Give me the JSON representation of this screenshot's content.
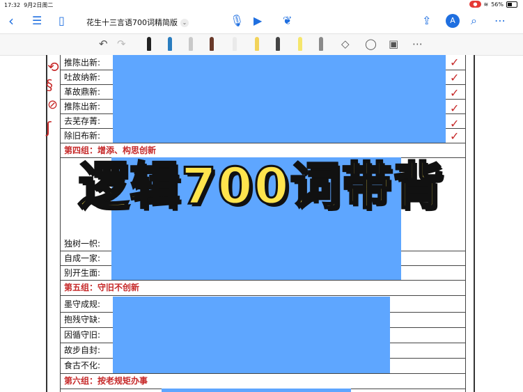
{
  "status": {
    "time": "17:32",
    "date": "9月2日周二",
    "battery": "56%"
  },
  "topbar": {
    "title": "花生十三言语700词精简版",
    "chevron": "⌄"
  },
  "overlay": {
    "title": "逻辑700词带背"
  },
  "rows_top": [
    {
      "label": "推陈出新:"
    },
    {
      "label": "吐故纳新:"
    },
    {
      "label": "革故鼎新:"
    },
    {
      "label": "推陈出新:"
    },
    {
      "label": "去芜存菁:"
    },
    {
      "label": "除旧布新:"
    }
  ],
  "group4": "第四组：增添、构思创新",
  "rows_mid": [
    {
      "label": "独树一帜:"
    },
    {
      "label": "自成一家:"
    },
    {
      "label": "别开生面:"
    }
  ],
  "group5": "第五组：守旧不创新",
  "rows_bottom": [
    {
      "label": "墨守成规:"
    },
    {
      "label": "抱残守缺:"
    },
    {
      "label": "因循守旧:"
    },
    {
      "label": "故步自封:"
    },
    {
      "label": "食古不化:"
    }
  ],
  "group6": "第六组：按老规矩办事",
  "icons": {
    "back": "back-chevron-icon",
    "list": "list-icon",
    "sidebar": "sidebar-icon",
    "mic": "microphone-icon",
    "play": "play-icon",
    "bird": "bird-icon",
    "share": "share-icon",
    "search": "search-icon",
    "more": "more-icon"
  },
  "colors": {
    "accent": "#1f6fe0",
    "mask": "#5ea6ff",
    "red": "#c62828",
    "overlay": "#ffe44d"
  }
}
